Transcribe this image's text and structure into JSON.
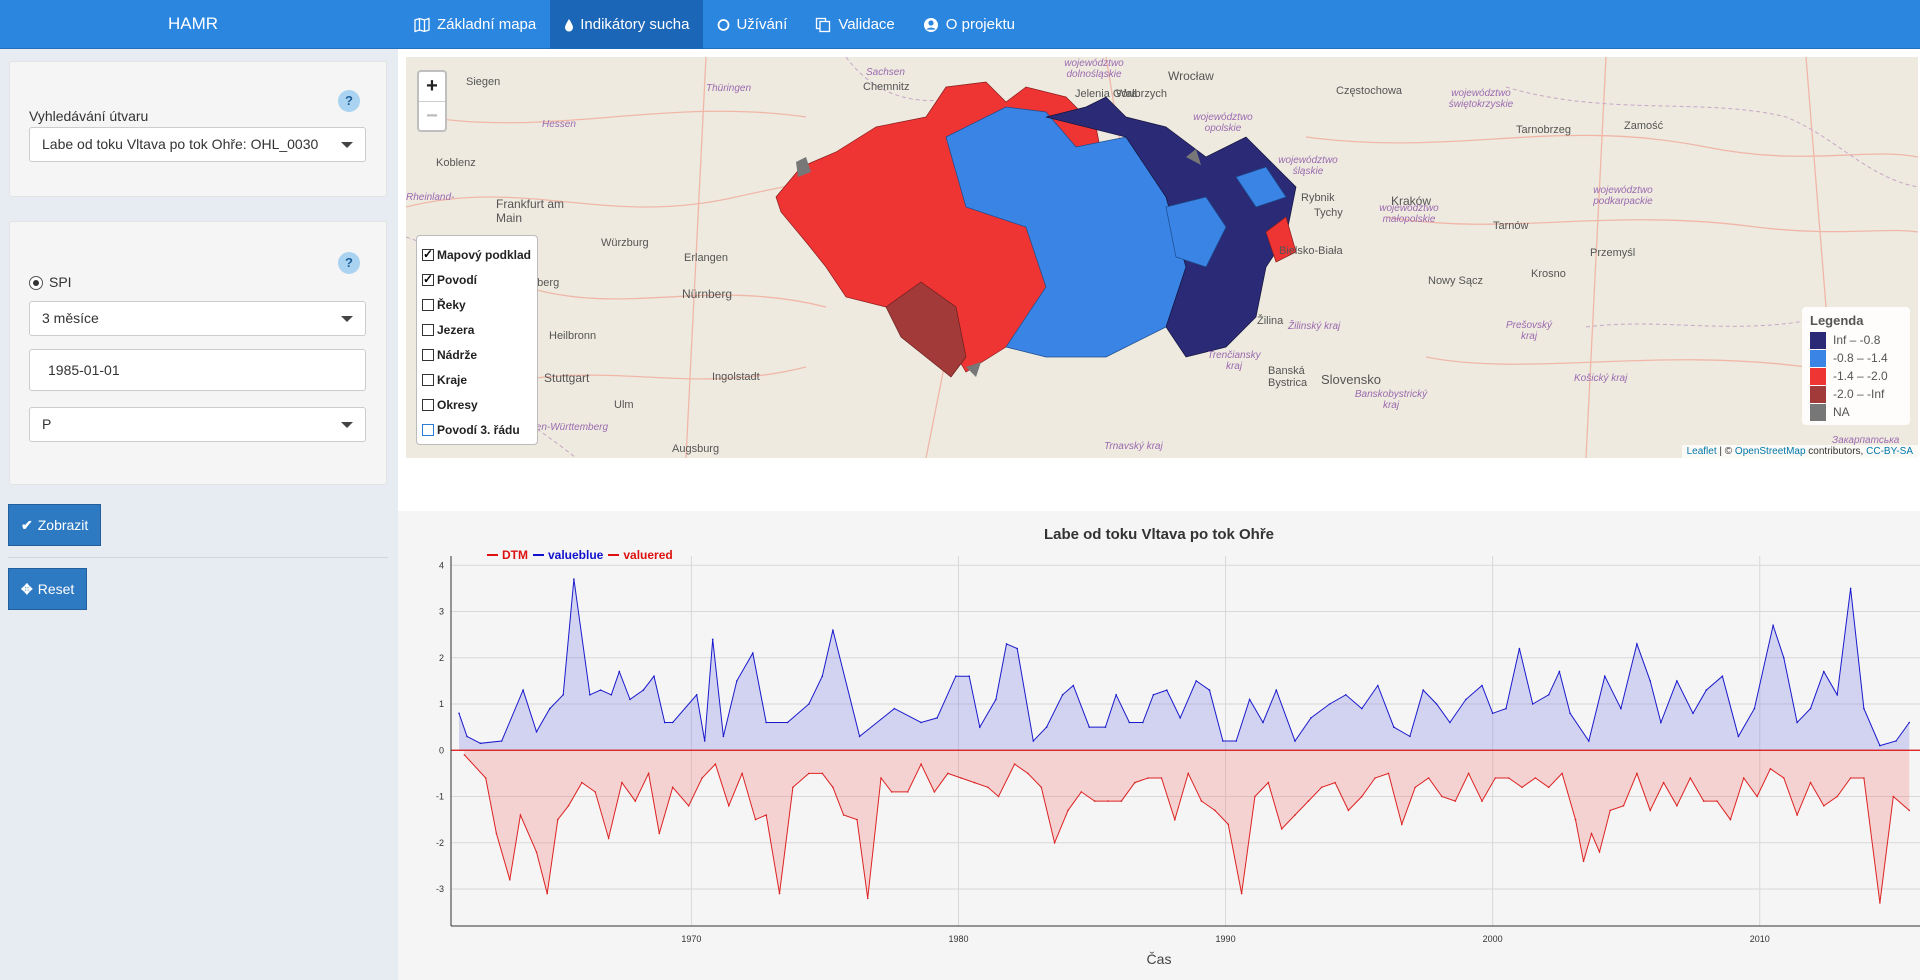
{
  "navbar": {
    "brand": "HAMR",
    "items": [
      {
        "label": "Základní mapa",
        "icon": "map-icon",
        "active": false
      },
      {
        "label": "Indikátory sucha",
        "icon": "droplet-icon",
        "active": true
      },
      {
        "label": "Užívání",
        "icon": "circle-icon",
        "active": false
      },
      {
        "label": "Validace",
        "icon": "copy-icon",
        "active": false
      },
      {
        "label": "O projektu",
        "icon": "user-circle-icon",
        "active": false
      }
    ]
  },
  "sidebar": {
    "search": {
      "label": "Vyhledávání útvaru",
      "help": "?",
      "selected": "Labe od toku Vltava po tok Ohře: OHL_0030"
    },
    "indicator": {
      "help": "?",
      "radio_label": "SPI",
      "period": "3 měsíce",
      "date": "1985-01-01",
      "variable": "P"
    },
    "show_button": "Zobrazit",
    "reset_button": "Reset"
  },
  "map": {
    "zoom_in": "+",
    "zoom_out": "−",
    "layers": [
      {
        "label": "Mapový podklad",
        "checked": true
      },
      {
        "label": "Povodí",
        "checked": true
      },
      {
        "label": "Řeky",
        "checked": false
      },
      {
        "label": "Jezera",
        "checked": false
      },
      {
        "label": "Nádrže",
        "checked": false
      },
      {
        "label": "Kraje",
        "checked": false
      },
      {
        "label": "Okresy",
        "checked": false
      },
      {
        "label": "Povodí 3. řádu",
        "checked": false
      }
    ],
    "legend": {
      "title": "Legenda",
      "items": [
        {
          "label": "Inf – -0.8",
          "color": "#2a2a77"
        },
        {
          "label": "-0.8 – -1.4",
          "color": "#3a84e6"
        },
        {
          "label": "-1.4 – -2.0",
          "color": "#ef3434"
        },
        {
          "label": "-2.0 – -Inf",
          "color": "#a33a3a"
        },
        {
          "label": "NA",
          "color": "#777777"
        }
      ]
    },
    "attribution": {
      "leaflet": "Leaflet",
      "sep": " | © ",
      "osm": "OpenStreetMap",
      "contributors": " contributors, ",
      "license": "CC-BY-SA"
    },
    "cities": [
      "Siegen",
      "Chemnitz",
      "Jelenia Góra",
      "Wałbrzych",
      "Wrocław",
      "Częstochowa",
      "Koblenz",
      "Frankfurt am Main",
      "Würzburg",
      "Erlangen",
      "Nürnberg",
      "Heilbronn",
      "Stuttgart",
      "Ingolstadt",
      "Ulm",
      "Augsburg",
      "Rybnik",
      "Tychy",
      "Kraków",
      "Tarnów",
      "Tarnobrzeg",
      "Zamość",
      "Bielsko-Biała",
      "Nowy Sącz",
      "Krosno",
      "Przemyśl",
      "Žilina",
      "Banská Bystrica",
      "Slovensko",
      "Heidelberg"
    ],
    "regions": [
      "województwo dolnośląskie",
      "Sachsen",
      "Thüringen",
      "Hessen",
      "województwo opolskie",
      "województwo świętokrzyskie",
      "województwo śląskie",
      "województwo małopolskie",
      "województwo podkarpackie",
      "Rheinland-",
      "Baden-Württemberg",
      "Žilinský kraj",
      "Prešovský kraj",
      "Trenčiansky kraj",
      "Košický kraj",
      "Banskobystrický kraj",
      "Trnavský kraj",
      "Закарпатська"
    ]
  },
  "chart_data": {
    "type": "area",
    "title": "Labe od toku Vltava po tok Ohře",
    "xlabel": "Čas",
    "ylabel": "",
    "legend": [
      "DTM",
      "valueblue",
      "valuered"
    ],
    "legend_colors": [
      "#dd1111",
      "#1111cc",
      "#dd1111"
    ],
    "xlim": [
      1961,
      2016
    ],
    "ylim": [
      -3.8,
      4.2
    ],
    "xticks": [
      1970,
      1980,
      1990,
      2000,
      2010
    ],
    "yticks": [
      -3,
      -2,
      -1,
      0,
      1,
      2,
      3,
      4
    ],
    "series": [
      {
        "name": "valueblue",
        "color": "#1a1acc",
        "points": [
          [
            1961.3,
            0.8
          ],
          [
            1961.6,
            0.3
          ],
          [
            1962.1,
            0.15
          ],
          [
            1962.9,
            0.2
          ],
          [
            1963.7,
            1.3
          ],
          [
            1964.2,
            0.4
          ],
          [
            1964.7,
            0.9
          ],
          [
            1965.2,
            1.2
          ],
          [
            1965.6,
            3.7
          ],
          [
            1966.2,
            1.2
          ],
          [
            1966.6,
            1.3
          ],
          [
            1967.0,
            1.2
          ],
          [
            1967.3,
            1.7
          ],
          [
            1967.7,
            1.1
          ],
          [
            1968.2,
            1.3
          ],
          [
            1968.6,
            1.6
          ],
          [
            1969.0,
            0.6
          ],
          [
            1969.3,
            0.6
          ],
          [
            1970.2,
            1.2
          ],
          [
            1970.5,
            0.2
          ],
          [
            1970.8,
            2.4
          ],
          [
            1971.2,
            0.3
          ],
          [
            1971.7,
            1.5
          ],
          [
            1972.3,
            2.1
          ],
          [
            1972.8,
            0.6
          ],
          [
            1973.6,
            0.6
          ],
          [
            1974.4,
            1.0
          ],
          [
            1974.9,
            1.6
          ],
          [
            1975.3,
            2.6
          ],
          [
            1976.3,
            0.3
          ],
          [
            1977.6,
            0.9
          ],
          [
            1978.6,
            0.6
          ],
          [
            1979.2,
            0.7
          ],
          [
            1979.9,
            1.6
          ],
          [
            1980.4,
            1.6
          ],
          [
            1980.8,
            0.5
          ],
          [
            1981.4,
            1.1
          ],
          [
            1981.8,
            2.3
          ],
          [
            1982.2,
            2.2
          ],
          [
            1982.8,
            0.2
          ],
          [
            1983.3,
            0.5
          ],
          [
            1983.9,
            1.2
          ],
          [
            1984.3,
            1.4
          ],
          [
            1984.9,
            0.5
          ],
          [
            1985.5,
            0.5
          ],
          [
            1985.9,
            1.2
          ],
          [
            1986.4,
            0.6
          ],
          [
            1986.9,
            0.6
          ],
          [
            1987.3,
            1.2
          ],
          [
            1987.8,
            1.3
          ],
          [
            1988.3,
            0.7
          ],
          [
            1988.9,
            1.5
          ],
          [
            1989.4,
            1.3
          ],
          [
            1989.9,
            0.2
          ],
          [
            1990.4,
            0.2
          ],
          [
            1990.9,
            1.1
          ],
          [
            1991.4,
            0.6
          ],
          [
            1991.9,
            1.3
          ],
          [
            1992.6,
            0.2
          ],
          [
            1993.2,
            0.7
          ],
          [
            1993.9,
            1.0
          ],
          [
            1994.5,
            1.2
          ],
          [
            1995.1,
            0.9
          ],
          [
            1995.7,
            1.4
          ],
          [
            1996.3,
            0.5
          ],
          [
            1996.9,
            0.3
          ],
          [
            1997.4,
            1.3
          ],
          [
            1997.9,
            1.0
          ],
          [
            1998.4,
            0.6
          ],
          [
            1999.0,
            1.1
          ],
          [
            1999.6,
            1.4
          ],
          [
            2000.0,
            0.8
          ],
          [
            2000.5,
            0.9
          ],
          [
            2001.0,
            2.2
          ],
          [
            2001.5,
            1.0
          ],
          [
            2002.1,
            1.2
          ],
          [
            2002.5,
            1.7
          ],
          [
            2002.9,
            0.8
          ],
          [
            2003.6,
            0.2
          ],
          [
            2004.2,
            1.6
          ],
          [
            2004.8,
            0.9
          ],
          [
            2005.4,
            2.3
          ],
          [
            2005.9,
            1.5
          ],
          [
            2006.3,
            0.6
          ],
          [
            2006.9,
            1.5
          ],
          [
            2007.5,
            0.8
          ],
          [
            2008.0,
            1.3
          ],
          [
            2008.6,
            1.6
          ],
          [
            2009.2,
            0.3
          ],
          [
            2009.8,
            0.9
          ],
          [
            2010.5,
            2.7
          ],
          [
            2010.9,
            2.0
          ],
          [
            2011.4,
            0.6
          ],
          [
            2011.9,
            0.9
          ],
          [
            2012.4,
            1.7
          ],
          [
            2012.9,
            1.2
          ],
          [
            2013.4,
            3.5
          ],
          [
            2013.9,
            0.9
          ],
          [
            2014.5,
            0.1
          ],
          [
            2015.1,
            0.2
          ],
          [
            2015.6,
            0.6
          ]
        ]
      },
      {
        "name": "valuered",
        "color": "#dd2222",
        "points": [
          [
            1961.5,
            -0.1
          ],
          [
            1962.3,
            -0.6
          ],
          [
            1962.7,
            -1.8
          ],
          [
            1963.2,
            -2.8
          ],
          [
            1963.6,
            -1.4
          ],
          [
            1964.2,
            -2.2
          ],
          [
            1964.6,
            -3.1
          ],
          [
            1965.0,
            -1.5
          ],
          [
            1965.4,
            -1.2
          ],
          [
            1965.9,
            -0.7
          ],
          [
            1966.4,
            -0.9
          ],
          [
            1966.9,
            -1.9
          ],
          [
            1967.4,
            -0.7
          ],
          [
            1967.9,
            -1.1
          ],
          [
            1968.4,
            -0.5
          ],
          [
            1968.8,
            -1.8
          ],
          [
            1969.3,
            -0.8
          ],
          [
            1969.9,
            -1.2
          ],
          [
            1970.4,
            -0.6
          ],
          [
            1970.9,
            -0.3
          ],
          [
            1971.4,
            -1.2
          ],
          [
            1971.9,
            -0.5
          ],
          [
            1972.4,
            -1.5
          ],
          [
            1972.8,
            -1.4
          ],
          [
            1973.3,
            -3.1
          ],
          [
            1973.8,
            -0.8
          ],
          [
            1974.4,
            -0.5
          ],
          [
            1974.9,
            -0.5
          ],
          [
            1975.3,
            -0.8
          ],
          [
            1975.7,
            -1.4
          ],
          [
            1976.2,
            -1.5
          ],
          [
            1976.6,
            -3.2
          ],
          [
            1977.1,
            -0.6
          ],
          [
            1977.5,
            -0.9
          ],
          [
            1978.1,
            -0.9
          ],
          [
            1978.6,
            -0.3
          ],
          [
            1979.1,
            -0.9
          ],
          [
            1979.6,
            -0.5
          ],
          [
            1980.1,
            -0.6
          ],
          [
            1980.6,
            -0.7
          ],
          [
            1981.1,
            -0.8
          ],
          [
            1981.5,
            -1.0
          ],
          [
            1982.1,
            -0.3
          ],
          [
            1982.6,
            -0.5
          ],
          [
            1983.1,
            -0.8
          ],
          [
            1983.6,
            -2.0
          ],
          [
            1984.1,
            -1.3
          ],
          [
            1984.6,
            -0.9
          ],
          [
            1985.1,
            -1.1
          ],
          [
            1985.6,
            -1.1
          ],
          [
            1986.1,
            -1.1
          ],
          [
            1986.6,
            -0.7
          ],
          [
            1987.1,
            -0.6
          ],
          [
            1987.6,
            -0.6
          ],
          [
            1988.1,
            -1.5
          ],
          [
            1988.6,
            -0.5
          ],
          [
            1989.1,
            -1.1
          ],
          [
            1989.6,
            -1.3
          ],
          [
            1990.1,
            -1.6
          ],
          [
            1990.6,
            -3.1
          ],
          [
            1991.1,
            -1.0
          ],
          [
            1991.6,
            -0.7
          ],
          [
            1992.1,
            -1.7
          ],
          [
            1992.6,
            -1.4
          ],
          [
            1993.1,
            -1.1
          ],
          [
            1993.6,
            -0.8
          ],
          [
            1994.1,
            -0.7
          ],
          [
            1994.6,
            -1.3
          ],
          [
            1995.1,
            -1.0
          ],
          [
            1995.6,
            -0.6
          ],
          [
            1996.1,
            -0.5
          ],
          [
            1996.6,
            -1.6
          ],
          [
            1997.1,
            -0.8
          ],
          [
            1997.6,
            -0.6
          ],
          [
            1998.1,
            -1.0
          ],
          [
            1998.6,
            -1.1
          ],
          [
            1999.1,
            -0.5
          ],
          [
            1999.6,
            -1.1
          ],
          [
            2000.1,
            -0.6
          ],
          [
            2000.6,
            -0.6
          ],
          [
            2001.1,
            -0.8
          ],
          [
            2001.6,
            -0.6
          ],
          [
            2002.1,
            -0.8
          ],
          [
            2002.6,
            -0.5
          ],
          [
            2003.1,
            -1.5
          ],
          [
            2003.4,
            -2.4
          ],
          [
            2003.7,
            -1.8
          ],
          [
            2004.0,
            -2.2
          ],
          [
            2004.4,
            -1.3
          ],
          [
            2004.9,
            -1.2
          ],
          [
            2005.4,
            -0.5
          ],
          [
            2005.9,
            -1.3
          ],
          [
            2006.4,
            -0.7
          ],
          [
            2006.9,
            -1.2
          ],
          [
            2007.4,
            -0.6
          ],
          [
            2007.9,
            -1.1
          ],
          [
            2008.4,
            -1.1
          ],
          [
            2008.9,
            -1.5
          ],
          [
            2009.4,
            -0.6
          ],
          [
            2009.9,
            -1.0
          ],
          [
            2010.4,
            -0.4
          ],
          [
            2010.9,
            -0.6
          ],
          [
            2011.4,
            -1.4
          ],
          [
            2011.9,
            -0.7
          ],
          [
            2012.4,
            -1.2
          ],
          [
            2012.9,
            -1.0
          ],
          [
            2013.4,
            -0.6
          ],
          [
            2013.9,
            -0.6
          ],
          [
            2014.5,
            -3.3
          ],
          [
            2015.0,
            -1.0
          ],
          [
            2015.6,
            -1.3
          ]
        ]
      },
      {
        "name": "DTM",
        "color": "#dd1111",
        "points": [
          [
            1961,
            0
          ],
          [
            2016,
            0
          ]
        ]
      }
    ]
  }
}
